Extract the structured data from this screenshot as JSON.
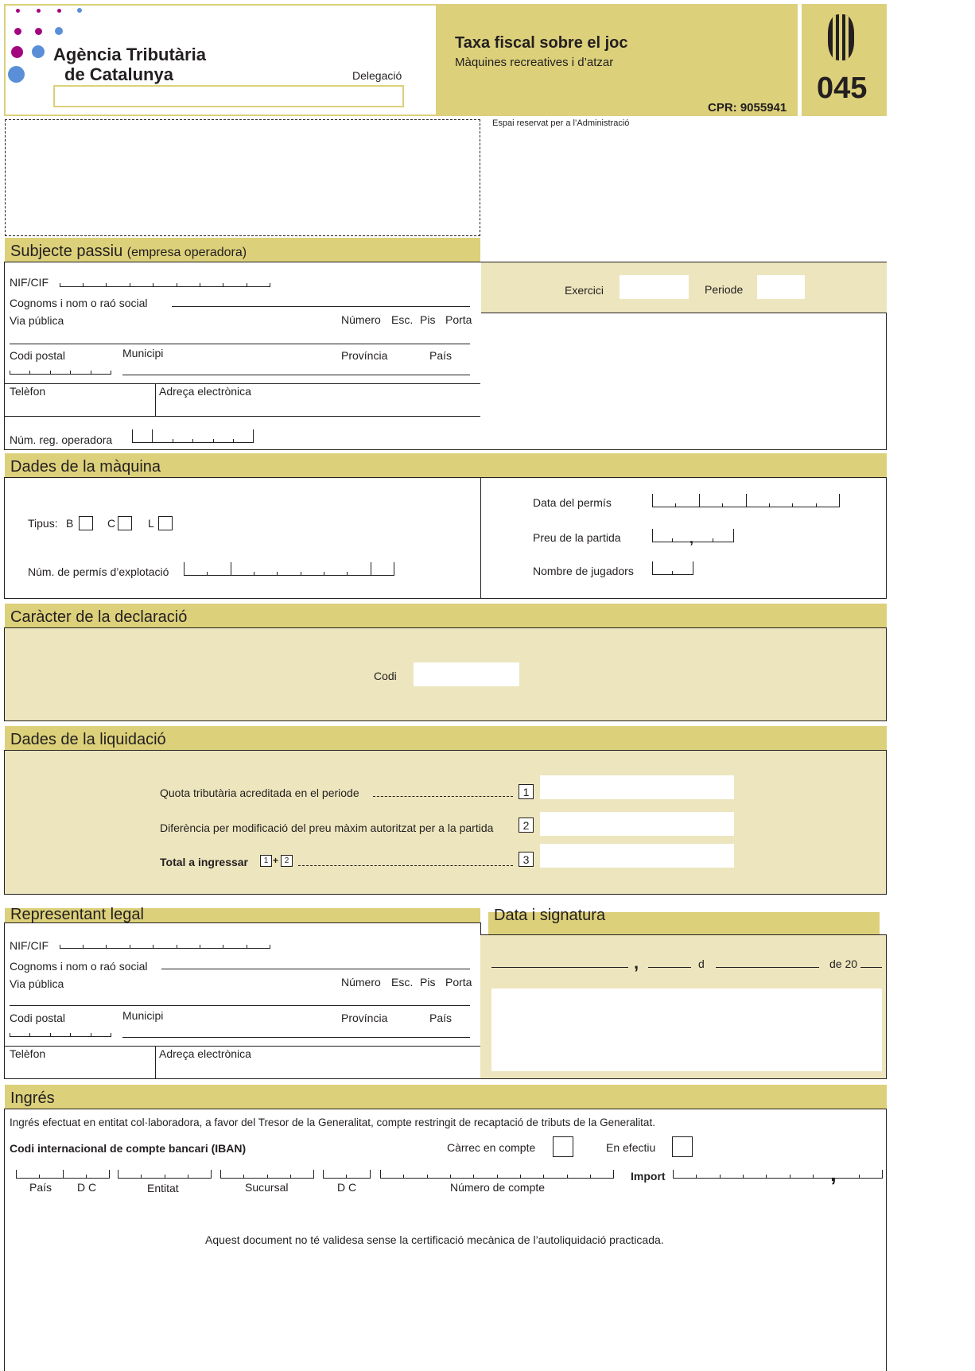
{
  "agency": {
    "name_line1": "Agència Tributària",
    "name_line2": "de Catalunya",
    "delegacio_label": "Delegació"
  },
  "header": {
    "title": "Taxa fiscal sobre el joc",
    "subtitle": "Màquines recreatives i d’atzar",
    "cpr": "CPR: 9055941",
    "model": "045"
  },
  "admin": {
    "label": "Espai reservat per a l’Administració"
  },
  "subjecte": {
    "title": "Subjecte passiu",
    "title_note": "(empresa operadora)",
    "nif": "NIF/CIF",
    "nom": "Cognoms i nom o raó social",
    "via": "Via pública",
    "numero": "Número",
    "esc": "Esc.",
    "pis": "Pis",
    "porta": "Porta",
    "cp": "Codi postal",
    "municipi": "Municipi",
    "provincia": "Província",
    "pais": "País",
    "telefon": "Telèfon",
    "email": "Adreça electrònica",
    "reg": "Núm. reg. operadora"
  },
  "periode": {
    "exercici": "Exercici",
    "periode": "Periode"
  },
  "maquina": {
    "title": "Dades de la màquina",
    "tipus": "Tipus:",
    "b": "B",
    "c": "C",
    "l": "L",
    "permis": "Núm. de permís d’explotació",
    "data": "Data del permís",
    "preu": "Preu de la partida",
    "jugadors": "Nombre de jugadors"
  },
  "caracter": {
    "title": "Caràcter de la declaració",
    "codi": "Codi"
  },
  "liquidacio": {
    "title": "Dades de la liquidació",
    "row1": "Quota tributària acreditada en el periode",
    "row2": "Diferència per modificació del preu màxim autoritzat per a la partida",
    "row3": "Total a ingressar",
    "n1": "1",
    "n2": "2",
    "n3": "3",
    "plus": "+"
  },
  "representant": {
    "title": "Representant legal",
    "nif": "NIF/CIF",
    "nom": "Cognoms i nom o raó social",
    "via": "Via pública",
    "numero": "Número",
    "esc": "Esc.",
    "pis": "Pis",
    "porta": "Porta",
    "cp": "Codi postal",
    "municipi": "Municipi",
    "provincia": "Província",
    "pais": "País",
    "telefon": "Telèfon",
    "email": "Adreça electrònica"
  },
  "signatura": {
    "title": "Data i signatura",
    "comma": ",",
    "d": "d",
    "de20": "de 20"
  },
  "ingres": {
    "title": "Ingrés",
    "desc": "Ingrés efectuat en entitat col·laboradora, a favor del Tresor de la Generalitat, compte restringit de recaptació de tributs de la Generalitat.",
    "iban": "Codi internacional de compte bancari (IBAN)",
    "carrec": "Càrrec en compte",
    "efectiu": "En efectiu",
    "pais": "País",
    "dc1": "D C",
    "entitat": "Entitat",
    "sucursal": "Sucursal",
    "dc2": "D C",
    "compte": "Número de compte",
    "import": "Import",
    "comma": ",",
    "footer": "Aquest document no té validesa sense la certificació mecànica de l’autoliquidació practicada."
  },
  "colors": {
    "header_band": "#dcd07a",
    "panel": "#ede5bd",
    "magenta": "#a3067e",
    "blue": "#5a8fd8"
  }
}
